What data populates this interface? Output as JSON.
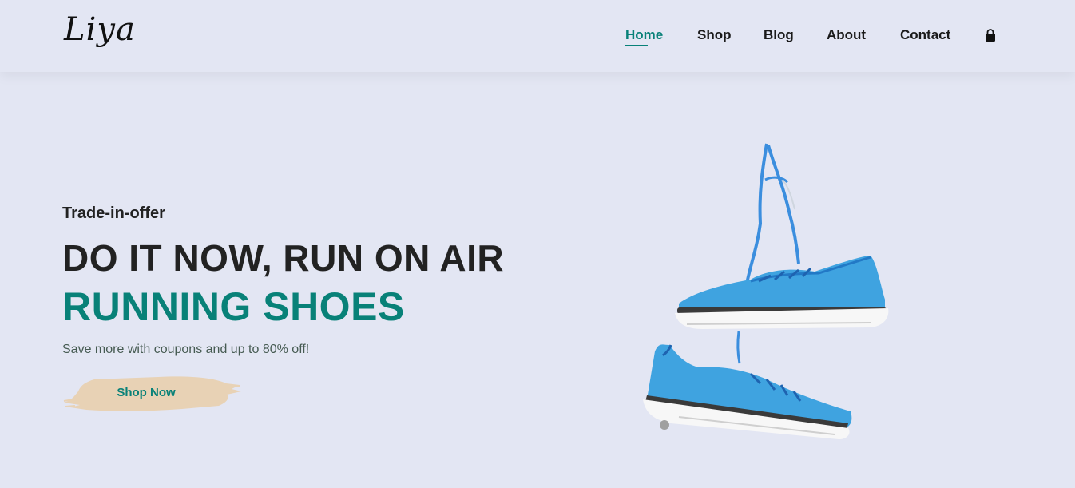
{
  "header": {
    "logo": "Liya",
    "nav": [
      {
        "label": "Home",
        "active": true
      },
      {
        "label": "Shop",
        "active": false
      },
      {
        "label": "Blog",
        "active": false
      },
      {
        "label": "About",
        "active": false
      },
      {
        "label": "Contact",
        "active": false
      }
    ],
    "cart_icon": "shopping-bag-icon"
  },
  "hero": {
    "subtitle": "Trade-in-offer",
    "title": "DO IT NOW, RUN ON AIR",
    "title_highlight": "RUNNING SHOES",
    "description": "Save more with coupons and up to 80% off!",
    "button_label": "Shop Now",
    "image": "hanging-running-shoes-image"
  },
  "colors": {
    "background": "#e3e6f3",
    "accent": "#088178",
    "button_brush": "#e8d2b5",
    "shoe": "#3fa3e0"
  }
}
